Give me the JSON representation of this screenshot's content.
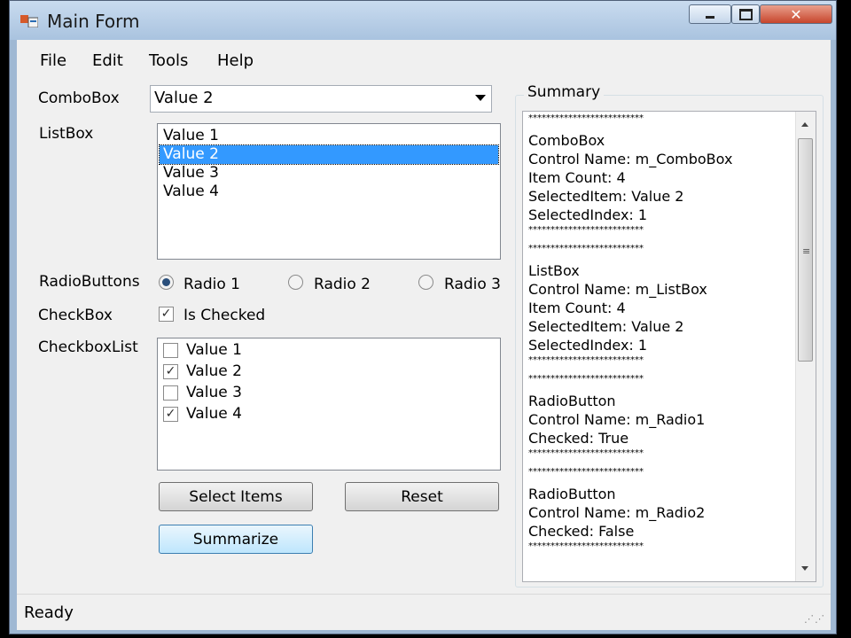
{
  "window": {
    "title": "Main Form",
    "minimize_icon": "minimize-icon",
    "maximize_icon": "maximize-icon",
    "close_icon": "close-icon"
  },
  "menu": [
    "File",
    "Edit",
    "Tools",
    "Help"
  ],
  "labels": {
    "combobox": "ComboBox",
    "listbox": "ListBox",
    "radiobuttons": "RadioButtons",
    "checkbox": "CheckBox",
    "checkboxlist": "CheckboxList"
  },
  "combobox": {
    "value": "Value 2"
  },
  "listbox": {
    "items": [
      "Value 1",
      "Value 2",
      "Value 3",
      "Value 4"
    ],
    "selected_index": 1
  },
  "radios": [
    {
      "label": "Radio 1",
      "checked": true
    },
    {
      "label": "Radio 2",
      "checked": false
    },
    {
      "label": "Radio 3",
      "checked": false
    }
  ],
  "checkbox": {
    "label": "Is Checked",
    "checked": true
  },
  "checkbox_list": [
    {
      "label": "Value 1",
      "checked": false
    },
    {
      "label": "Value 2",
      "checked": true
    },
    {
      "label": "Value 3",
      "checked": false
    },
    {
      "label": "Value 4",
      "checked": true
    }
  ],
  "buttons": {
    "select_items": "Select Items",
    "reset": "Reset",
    "summarize": "Summarize"
  },
  "summary": {
    "title": "Summary",
    "lines": [
      "**************************",
      "ComboBox",
      "Control Name: m_ComboBox",
      "Item Count: 4",
      "SelectedItem: Value 2",
      "SelectedIndex: 1",
      "**************************",
      "**************************",
      "ListBox",
      "Control Name: m_ListBox",
      "Item Count: 4",
      "SelectedItem: Value 2",
      "SelectedIndex: 1",
      "**************************",
      "**************************",
      "RadioButton",
      "Control Name: m_Radio1",
      "Checked: True",
      "**************************",
      "**************************",
      "RadioButton",
      "Control Name: m_Radio2",
      "Checked: False",
      "**************************"
    ]
  },
  "status": {
    "text": "Ready"
  }
}
